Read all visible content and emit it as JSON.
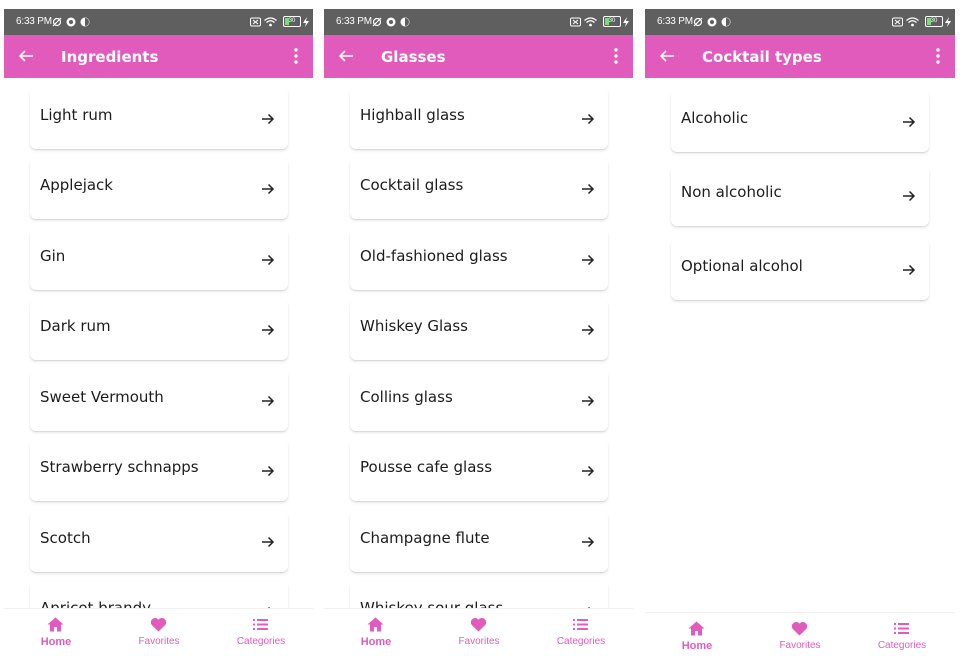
{
  "status_bar": {
    "time": "6:33 PM",
    "battery_level": "30",
    "battery_percent": 30
  },
  "theme": {
    "accent": "#e15bbd",
    "status_bar": "#5f5f5f",
    "text": "#1c1c1c"
  },
  "screens": [
    {
      "title": "Ingredients",
      "items": [
        "Light rum",
        "Applejack",
        "Gin",
        "Dark rum",
        "Sweet Vermouth",
        "Strawberry schnapps",
        "Scotch",
        "Apricot brandy"
      ]
    },
    {
      "title": "Glasses",
      "items": [
        "Highball glass",
        "Cocktail glass",
        "Old-fashioned glass",
        "Whiskey Glass",
        "Collins glass",
        "Pousse cafe glass",
        "Champagne flute",
        "Whiskey sour glass"
      ]
    },
    {
      "title": "Cocktail types",
      "items": [
        "Alcoholic",
        "Non alcoholic",
        "Optional alcohol"
      ]
    }
  ],
  "bottom_nav": [
    {
      "label": "Home",
      "icon": "home-icon",
      "active": true
    },
    {
      "label": "Favorites",
      "icon": "heart-icon",
      "active": false
    },
    {
      "label": "Categories",
      "icon": "list-icon",
      "active": false
    }
  ]
}
